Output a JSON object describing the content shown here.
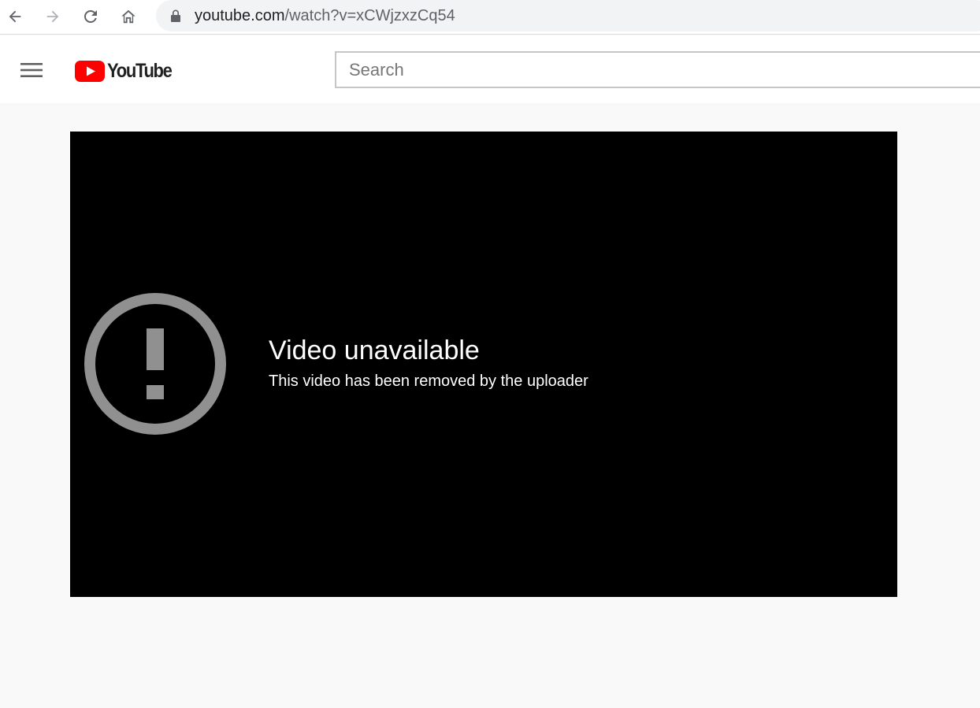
{
  "browser": {
    "url_host": "youtube.com",
    "url_path": "/watch?v=xCWjzxzCq54",
    "icons": {
      "back": "arrow-left-icon",
      "forward": "arrow-right-icon",
      "reload": "reload-icon",
      "home": "home-icon",
      "lock": "lock-icon"
    }
  },
  "header": {
    "logo_text": "YouTube",
    "search_placeholder": "Search",
    "search_value": "",
    "icons": {
      "menu": "hamburger-menu-icon",
      "logo": "youtube-play-icon"
    }
  },
  "player": {
    "error_title": "Video unavailable",
    "error_subtitle": "This video has been removed by the uploader",
    "icon": "exclamation-circle-icon"
  },
  "colors": {
    "brand_red": "#ff0000",
    "page_bg": "#f9f9f9",
    "player_bg": "#000000",
    "error_icon": "#909090"
  }
}
